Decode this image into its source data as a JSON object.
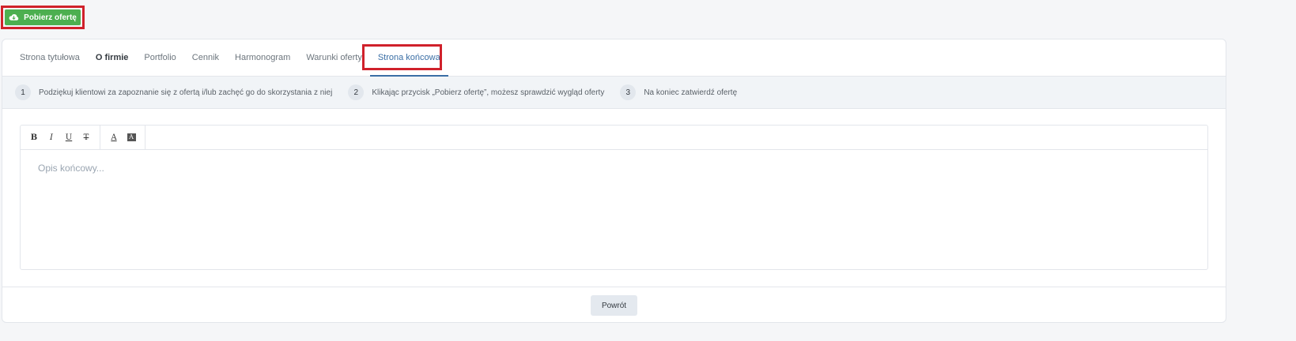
{
  "download_button": {
    "label": "Pobierz ofertę",
    "icon": "cloud-download-icon",
    "color": "#4caf50"
  },
  "tabs": [
    {
      "label": "Strona tytułowa",
      "state": "normal"
    },
    {
      "label": "O firmie",
      "state": "bold"
    },
    {
      "label": "Portfolio",
      "state": "normal"
    },
    {
      "label": "Cennik",
      "state": "normal"
    },
    {
      "label": "Harmonogram",
      "state": "normal"
    },
    {
      "label": "Warunki oferty",
      "state": "normal"
    },
    {
      "label": "Strona końcowa",
      "state": "active"
    }
  ],
  "steps": [
    {
      "number": "1",
      "text": "Podziękuj klientowi za zapoznanie się z ofertą i/lub zachęć go do skorzystania z niej"
    },
    {
      "number": "2",
      "text": "Klikając przycisk „Pobierz ofertę”, możesz sprawdzić wygląd oferty"
    },
    {
      "number": "3",
      "text": "Na koniec zatwierdź ofertę"
    }
  ],
  "editor": {
    "toolbar": {
      "bold": "B",
      "italic": "I",
      "underline": "U",
      "strike": "T",
      "text_color": "A",
      "background_color": "A"
    },
    "placeholder": "Opis końcowy..."
  },
  "footer": {
    "back_label": "Powrót"
  },
  "colors": {
    "highlight": "#d0212b",
    "accent": "#3a6ea5"
  }
}
